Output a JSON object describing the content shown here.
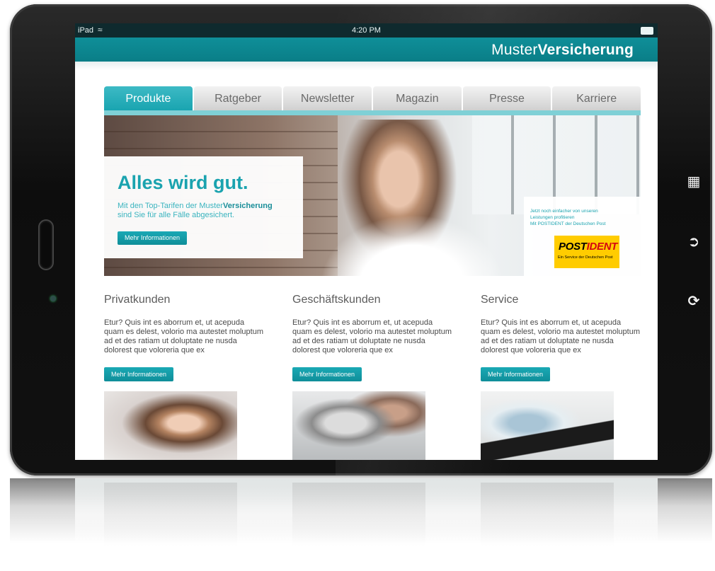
{
  "statusbar": {
    "device": "iPad",
    "time": "4:20 PM"
  },
  "header": {
    "brand_light": "Muster",
    "brand_bold": "Versicherung"
  },
  "nav": {
    "tabs": [
      {
        "label": "Produkte",
        "active": true
      },
      {
        "label": "Ratgeber",
        "active": false
      },
      {
        "label": "Newsletter",
        "active": false
      },
      {
        "label": "Magazin",
        "active": false
      },
      {
        "label": "Presse",
        "active": false
      },
      {
        "label": "Karriere",
        "active": false
      }
    ]
  },
  "hero": {
    "title": "Alles wird gut.",
    "subtitle_pre": "Mit den Top-Tarifen der Muster",
    "subtitle_brand": "Versicherung",
    "subtitle_post": "sind Sie für alle Fälle abgesichert.",
    "button": "Mehr Informationen"
  },
  "postident": {
    "line1": "Jetzt noch einfacher von unseren",
    "line2": "Leistungen profitieren",
    "line3": "Mit POSTIDENT der Deutschen Post",
    "logo_post": "POST",
    "logo_ident": "IDENT",
    "logo_sub": "Ein Service der Deutschen Post"
  },
  "columns": [
    {
      "title": "Privatkunden",
      "text": "Etur? Quis int es aborrum et, ut acepuda quam es delest, volorio ma autestet moluptum ad et des ratiam ut doluptate ne nusda dolorest que voloreria que ex",
      "button": "Mehr Informationen"
    },
    {
      "title": "Geschäftskunden",
      "text": "Etur? Quis int es aborrum et, ut acepuda quam es delest, volorio ma autestet moluptum ad et des ratiam ut doluptate ne nusda dolorest que voloreria que ex",
      "button": "Mehr Informationen"
    },
    {
      "title": "Service",
      "text": "Etur? Quis int es aborrum et, ut acepuda quam es delest, volorio ma autestet moluptum ad et des ratiam ut doluptate ne nusda dolorest que voloreria que ex",
      "button": "Mehr Informationen"
    }
  ],
  "colors": {
    "accent": "#1aa3af",
    "header": "#0f8f99",
    "postident_yellow": "#ffcc00",
    "postident_red": "#d40511"
  },
  "icons": {
    "side": [
      "grid-icon",
      "share-icon",
      "refresh-icon"
    ]
  }
}
